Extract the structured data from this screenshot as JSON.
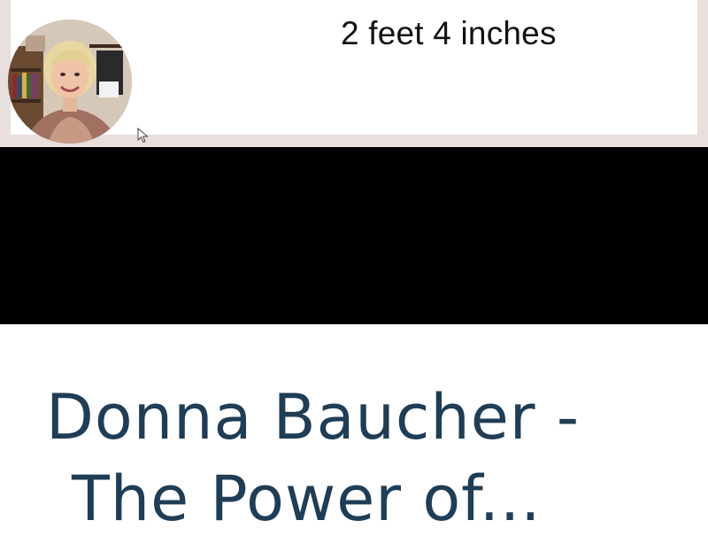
{
  "video": {
    "slide_text": "2 feet 4 inches",
    "presenter_avatar_icon": "presenter-avatar",
    "cursor_icon": "mouse-pointer-icon"
  },
  "page": {
    "title_line1": "Donna Baucher -",
    "title_line2": "The Power of..."
  },
  "colors": {
    "title": "#1f3d55",
    "video_border": "#e9dfdc",
    "video_black": "#000000"
  }
}
